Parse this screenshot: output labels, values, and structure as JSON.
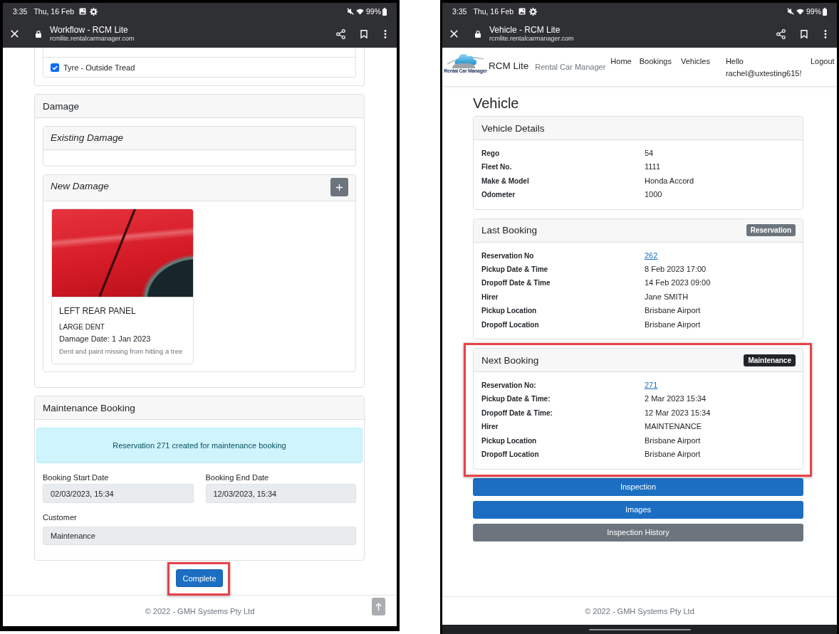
{
  "workflow_screen": {
    "status_bar": {
      "time": "3:35",
      "date": "Thu, 16 Feb",
      "battery": "99%"
    },
    "browser_bar": {
      "title": "Workflow - RCM Lite",
      "url": "rcmlite.rentalcarmanager.com"
    },
    "checklist": [
      {
        "label": "Tyre - Outside Tread",
        "checked": true
      }
    ],
    "damage": {
      "title": "Damage",
      "existing_damage": {
        "title": "Existing Damage"
      },
      "new_damage": {
        "title": "New Damage",
        "items": [
          {
            "location": "LEFT REAR PANEL",
            "type": "LARGE DENT",
            "date": "Damage Date: 1 Jan 2023",
            "description": "Dent and paint missing from hitting a tree"
          }
        ]
      }
    },
    "maintenance_booking": {
      "title": "Maintenance Booking",
      "alert": "Reservation 271 created for maintenance booking",
      "fields": [
        {
          "label": "Booking Start Date",
          "value": "02/03/2023, 15:34",
          "disabled": true
        },
        {
          "label": "Booking End Date",
          "value": "12/03/2023, 15:34",
          "disabled": true
        },
        {
          "label": "Customer",
          "value": "Maintenance",
          "disabled": true
        }
      ]
    },
    "complete_button": {
      "label": "Complete",
      "highlighted": true
    },
    "footer": "© 2022 - GMH Systems Pty Ltd"
  },
  "vehicle_screen": {
    "status_bar": {
      "time": "3:35",
      "date": "Thu, 16 Feb",
      "battery": "99%"
    },
    "browser_bar": {
      "title": "Vehicle - RCM Lite",
      "url": "rcmlite.rentalcarmanager.com"
    },
    "navbar": {
      "logo_caption": "Rental Car Manager",
      "brand": "RCM Lite",
      "tagline": "Rental Car Manager",
      "links": [
        "Home",
        "Bookings",
        "Vehicles"
      ],
      "greeting": "Hello rachel@uxtesting615!",
      "logout": "Logout"
    },
    "title": "Vehicle",
    "cards": [
      {
        "title": "Vehicle Details",
        "highlighted": false,
        "rows": [
          {
            "label": "Rego",
            "value": "54",
            "link": false
          },
          {
            "label": "Fleet No.",
            "value": "1111",
            "link": false
          },
          {
            "label": "Make & Model",
            "value": "Honda Accord",
            "link": false
          },
          {
            "label": "Odometer",
            "value": "1000",
            "link": false
          }
        ]
      },
      {
        "title": "Last Booking",
        "badge": {
          "text": "Reservation",
          "kind": "secondary"
        },
        "highlighted": false,
        "rows": [
          {
            "label": "Reservation No",
            "value": "262",
            "link": true
          },
          {
            "label": "Pickup Date & Time",
            "value": "8 Feb 2023 17:00",
            "link": false
          },
          {
            "label": "Dropoff Date & Time",
            "value": "14 Feb 2023 09:00",
            "link": false
          },
          {
            "label": "Hirer",
            "value": "Jane SMITH",
            "link": false
          },
          {
            "label": "Pickup Location",
            "value": "Brisbane Airport",
            "link": false
          },
          {
            "label": "Dropoff Location",
            "value": "Brisbane Airport",
            "link": false
          }
        ]
      },
      {
        "title": "Next Booking",
        "badge": {
          "text": "Maintenance",
          "kind": "dark"
        },
        "highlighted": true,
        "rows": [
          {
            "label": "Reservation No:",
            "value": "271",
            "link": true
          },
          {
            "label": "Pickup Date & Time:",
            "value": "2 Mar 2023 15:34",
            "link": false
          },
          {
            "label": "Dropoff Date & Time:",
            "value": "12 Mar 2023 15:34",
            "link": false
          },
          {
            "label": "Hirer",
            "value": "MAINTENANCE",
            "link": false
          },
          {
            "label": "Pickup Location",
            "value": "Brisbane Airport",
            "link": false
          },
          {
            "label": "Dropoff Location",
            "value": "Brisbane Airport",
            "link": false
          }
        ]
      }
    ],
    "buttons": [
      {
        "label": "Inspection",
        "kind": "primary"
      },
      {
        "label": "Images",
        "kind": "primary"
      },
      {
        "label": "Inspection History",
        "kind": "secondary"
      }
    ],
    "footer": "© 2022 - GMH Systems Pty Ltd"
  }
}
